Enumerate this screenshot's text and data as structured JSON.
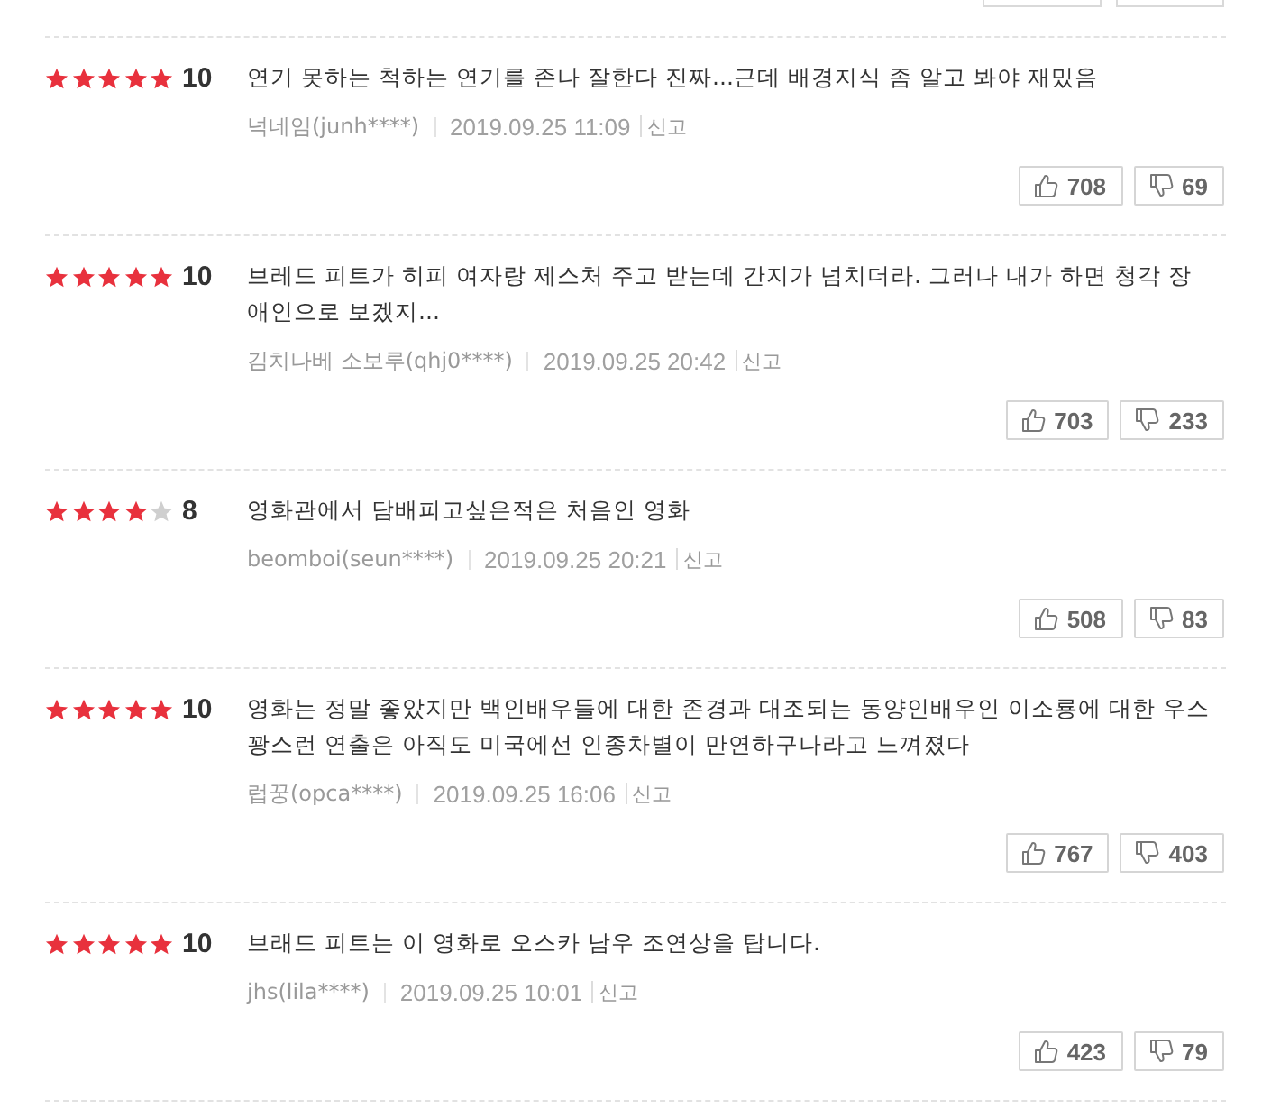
{
  "reviews": [
    {
      "stars": 5,
      "score": "10",
      "text": "연기 못하는 척하는 연기를 존나 잘한다 진짜...근데 배경지식 좀 알고 봐야 재밌음",
      "author": "넉네임(junh****)",
      "date": "2019.09.25 11:09",
      "report": "신고",
      "likes": "708",
      "dislikes": "69"
    },
    {
      "stars": 5,
      "score": "10",
      "text": "브레드 피트가 히피 여자랑 제스처 주고 받는데 간지가 넘치더라. 그러나 내가 하면 청각 장애인으로 보겠지...",
      "author": "김치나베 소보루(qhj0****)",
      "date": "2019.09.25 20:42",
      "report": "신고",
      "likes": "703",
      "dislikes": "233"
    },
    {
      "stars": 4,
      "score": "8",
      "text": "영화관에서 담배피고싶은적은 처음인 영화",
      "author": "beomboi(seun****)",
      "date": "2019.09.25 20:21",
      "report": "신고",
      "likes": "508",
      "dislikes": "83"
    },
    {
      "stars": 5,
      "score": "10",
      "text": "영화는 정말 좋았지만 백인배우들에 대한 존경과 대조되는 동양인배우인 이소룡에 대한 우스꽝스런 연출은 아직도 미국에선 인종차별이 만연하구나라고 느껴졌다",
      "author": "럽꿍(opca****)",
      "date": "2019.09.25 16:06",
      "report": "신고",
      "likes": "767",
      "dislikes": "403"
    },
    {
      "stars": 5,
      "score": "10",
      "text": "브래드 피트는 이 영화로 오스카 남우 조연상을 탑니다.",
      "author": "jhs(lila****)",
      "date": "2019.09.25 10:01",
      "report": "신고",
      "likes": "423",
      "dislikes": "79"
    }
  ]
}
